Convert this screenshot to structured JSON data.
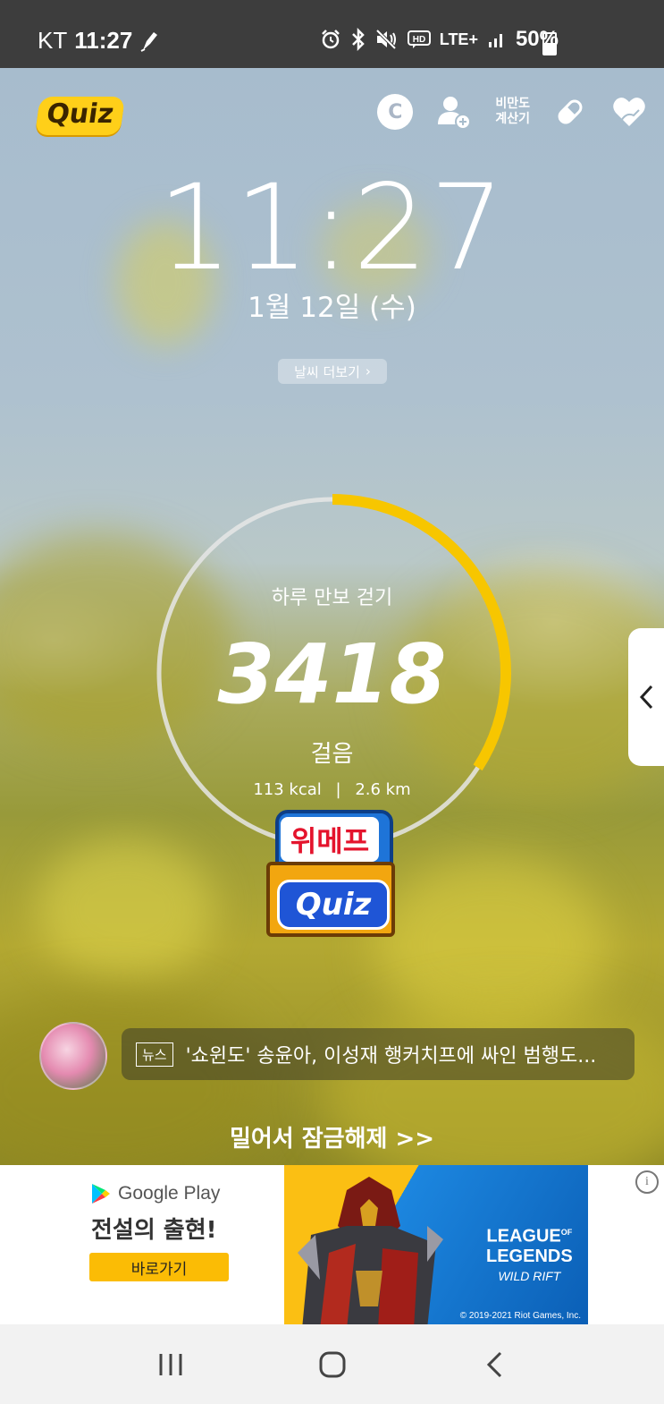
{
  "status_bar": {
    "carrier": "KT",
    "time": "11:27",
    "network": "LTE+",
    "battery_percent": "50%"
  },
  "top": {
    "quiz_logo": "Quiz",
    "coin_label": "C",
    "bmi_line1": "비만도",
    "bmi_line2": "계산기"
  },
  "clock": {
    "time": "11:27",
    "date": "1월 12일 (수)",
    "weather_more": "날씨 더보기"
  },
  "steps": {
    "title": "하루 만보 걷기",
    "count": "3418",
    "unit": "걸음",
    "kcal": "113 kcal",
    "distance": "2.6 km",
    "goal_progress": 0.3418
  },
  "promo": {
    "brand": "위메프",
    "quiz": "Quiz"
  },
  "news": {
    "tag": "뉴스",
    "headline": "'쇼윈도' 송윤아, 이성재 행커치프에 싸인 범행도..."
  },
  "unlock": {
    "text": "밀어서 잠금해제 >>"
  },
  "ad": {
    "store": "Google Play",
    "headline": "전설의 출현!",
    "cta": "바로가기",
    "game_title_1": "LEAGUE",
    "game_title_of": "OF",
    "game_title_2": "LEGENDS",
    "game_subtitle": "WILD RIFT",
    "copyright": "© 2019-2021 Riot Games, Inc.",
    "info": "i",
    "colors": {
      "cta": "#fbbc05",
      "banner_blue": "#1c86df",
      "banner_yellow": "#fbbf13"
    }
  },
  "colors": {
    "ring_progress": "#f7c600",
    "ring_track": "#e6e6e6",
    "status_bar": "#3d3d3d"
  }
}
